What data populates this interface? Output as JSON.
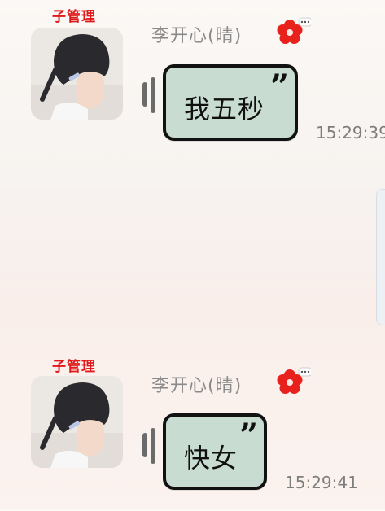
{
  "messages": [
    {
      "role_tag": "子管理",
      "sender": "李开心(晴)",
      "text": "我五秒",
      "quote_mark": "”",
      "time": "15:29:39"
    },
    {
      "role_tag": "子管理",
      "sender": "李开心(晴)",
      "text": "快女",
      "quote_mark": "”",
      "time": "15:29:41"
    }
  ],
  "colors": {
    "bubble_fill": "#c9dcd2",
    "bubble_border": "#111111",
    "role_tag": "#e0191b",
    "flower": "#e8211d",
    "name_text": "#8a8a8a"
  },
  "icons": {
    "flower": "red-flower-icon",
    "voice": "voice-wave-icon",
    "more": "ellipsis-icon"
  }
}
